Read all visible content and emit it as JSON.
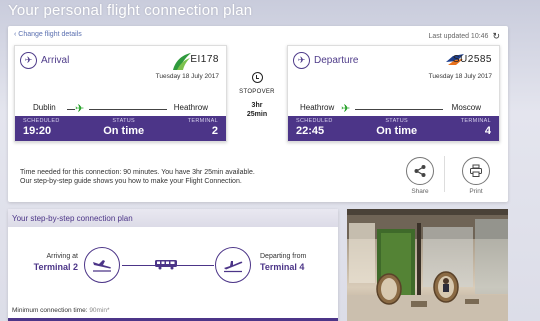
{
  "page": {
    "title": "Your personal flight connection plan"
  },
  "header": {
    "change_link": "‹ Change flight details",
    "updated": "Last updated 10:46"
  },
  "arrival": {
    "title": "Arrival",
    "flight": "EI178",
    "date": "Tuesday 18 July 2017",
    "from": "Dublin",
    "to": "Heathrow",
    "scheduled_label": "SCHEDULED",
    "scheduled": "19:20",
    "status_label": "STATUS",
    "status": "On time",
    "terminal_label": "TERMINAL",
    "terminal": "2"
  },
  "departure": {
    "title": "Departure",
    "flight": "SU2585",
    "date": "Tuesday 18 July 2017",
    "from": "Heathrow",
    "to": "Moscow",
    "scheduled_label": "SCHEDULED",
    "scheduled": "22:45",
    "status_label": "STATUS",
    "status": "On time",
    "terminal_label": "TERMINAL",
    "terminal": "4"
  },
  "stopover": {
    "label": "STOPOVER",
    "hours": "3hr",
    "minutes": "25min"
  },
  "info": {
    "line1": "Time needed for this connection: 90 minutes. You have 3hr 25min available.",
    "line2": "Our step-by-step guide shows you how to make your Flight Connection."
  },
  "actions": {
    "share": "Share",
    "print": "Print"
  },
  "steps": {
    "title": "Your step-by-step connection plan",
    "arriving_label": "Arriving at",
    "arriving_terminal": "Terminal 2",
    "departing_label": "Departing from",
    "departing_terminal": "Terminal 4",
    "min_label": "Minimum connection time:",
    "min_value": "90min*"
  },
  "colors": {
    "accent": "#4c3588",
    "green_plane": "#27a22a",
    "aer_lingus_green": "#2f9a3d",
    "aeroflot_blue": "#1f3f8c",
    "aeroflot_orange": "#e8711d"
  }
}
